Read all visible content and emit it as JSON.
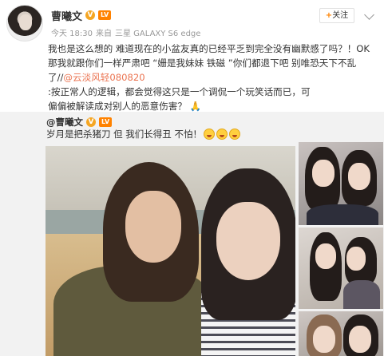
{
  "author": {
    "name": "曹曦文",
    "v_badge": "V",
    "rank_badge": "LV",
    "time": "今天 18:30",
    "source_prefix": "来自",
    "source_device": "三星 GALAXY S6 edge"
  },
  "actions": {
    "follow_plus": "+",
    "follow_label": "关注"
  },
  "post": {
    "line1": "我也是这么想的  难道现在的小盆友真的已经平乏到完全没有幽默感了吗？！OK",
    "line2": "那我就跟你们一样严肃吧 “姗是我妹妹 铁磁 ”你们都退下吧 别唯恐天下不乱了//",
    "mention": "@云淡风轻080820",
    "line3_tail": ":按正常人的逻辑，都会觉得这只是一个调侃一个玩笑话而已，可",
    "line4": "偏偏被解读成对别人的恶意伤害？",
    "clap_glyph": "🙏"
  },
  "repost": {
    "mention": "@曹曦文",
    "v_badge": "V",
    "rank_badge": "LV",
    "text": "岁月是把杀猪刀 但 我们长得丑 不怕！",
    "emoji_count_label": "😂"
  },
  "icons": {
    "chevron": "chevron-down-icon",
    "emoji": "laugh-cry-emoji-icon"
  },
  "colors": {
    "accent": "#ff8200",
    "mention": "#eb7350",
    "repost_bg": "#f2f2f2"
  }
}
